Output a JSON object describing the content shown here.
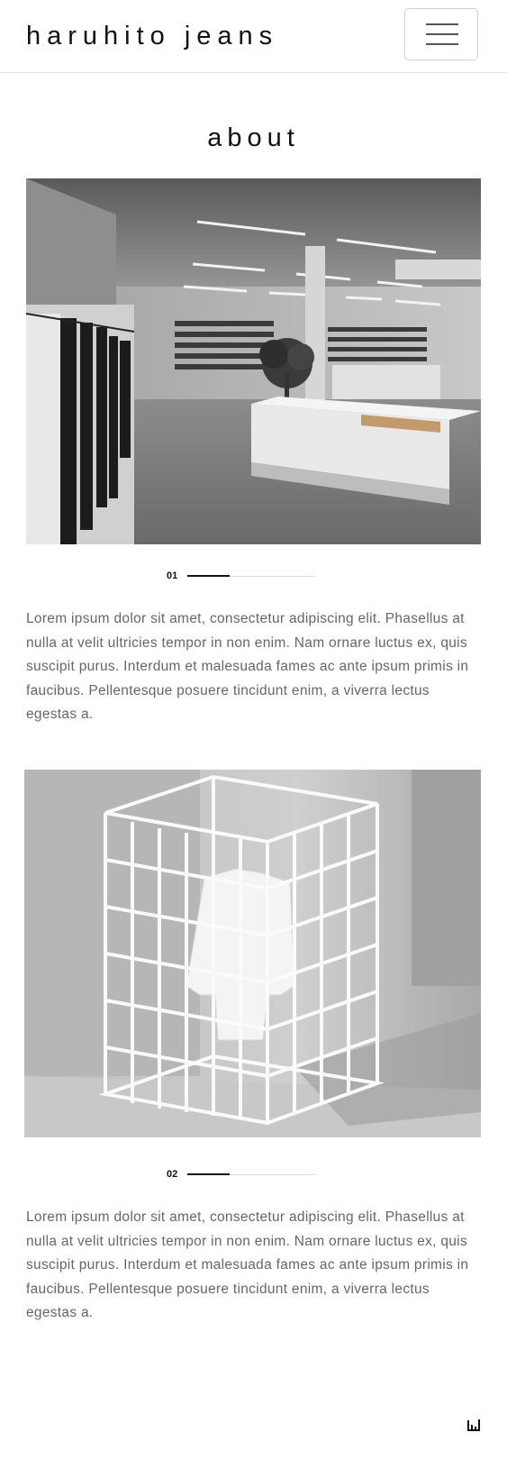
{
  "header": {
    "brand": "haruhito jeans",
    "menu_icon": "hamburger-menu-icon"
  },
  "page": {
    "title": "about"
  },
  "sections": [
    {
      "index": "01",
      "image_alt": "concrete store interior with clothing rack, sneaker wall and white display table",
      "slide_progress": 0.33,
      "text": "Lorem ipsum dolor sit amet, consectetur adipiscing elit. Phasellus at nulla at velit ultricies tempor in non enim. Nam ornare luctus ex, quis suscipit purus. Interdum et malesuada fames ac ante ipsum primis in faucibus. Pellentesque posuere tincidunt enim, a viverra lectus egestas a."
    },
    {
      "index": "02",
      "image_alt": "white wire grid cage displaying a white jacket",
      "slide_progress": 0.33,
      "text": "Lorem ipsum dolor sit amet, consectetur adipiscing elit. Phasellus at nulla at velit ultricies tempor in non enim. Nam ornare luctus ex, quis suscipit purus. Interdum et malesuada fames ac ante ipsum primis in faucibus. Pellentesque posuere tincidunt enim, a viverra lectus egestas a."
    }
  ],
  "footer": {
    "corner_icon": "bar-logo-icon"
  }
}
